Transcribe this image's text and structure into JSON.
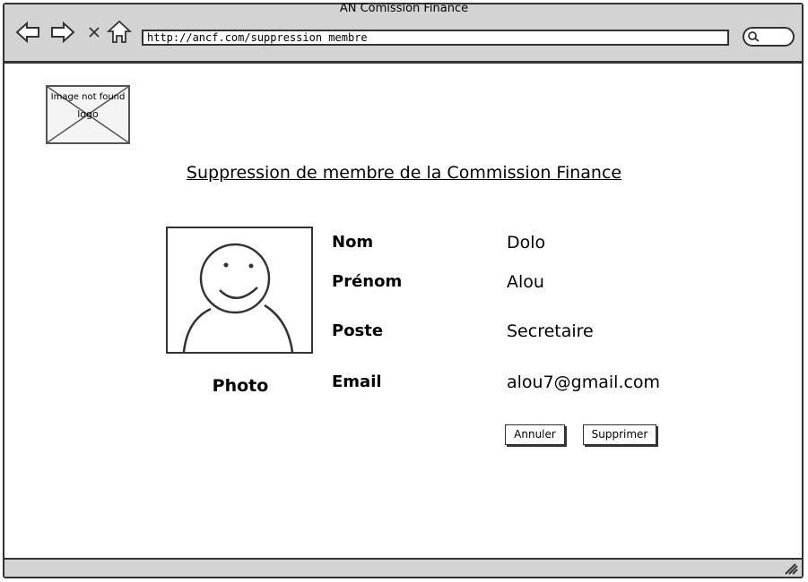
{
  "window": {
    "title": "AN Comission Finance"
  },
  "browser": {
    "url": "http://ancf.com/suppression membre",
    "nav": {
      "back_icon": "arrow-left-icon",
      "forward_icon": "arrow-right-icon",
      "stop_icon": "close-icon",
      "home_icon": "home-icon",
      "search_icon": "search-icon"
    }
  },
  "logo": {
    "line1": "Image not found",
    "line2": "logo"
  },
  "page": {
    "title": "Suppression de membre de la Commission Finance"
  },
  "member": {
    "photo_label": "Photo",
    "fields": [
      {
        "label": "Nom",
        "value": "Dolo"
      },
      {
        "label": "Prénom",
        "value": "Alou"
      },
      {
        "label": "Poste",
        "value": "Secretaire"
      },
      {
        "label": "Email",
        "value": "alou7@gmail.com"
      }
    ]
  },
  "actions": {
    "cancel": "Annuler",
    "delete": "Supprimer"
  }
}
